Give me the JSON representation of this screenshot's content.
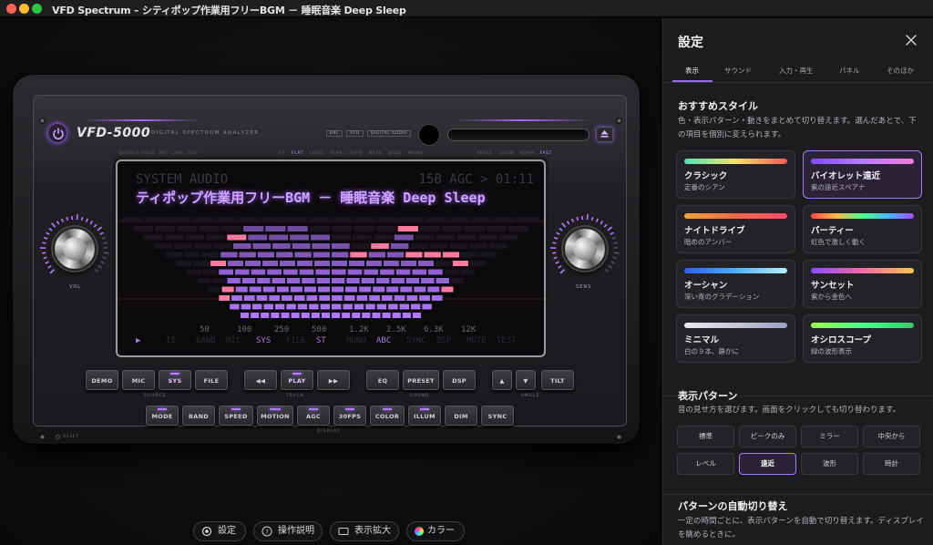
{
  "window": {
    "title": "VFD Spectrum – シティポップ作業用フリーBGM － 睡眠音楽 Deep Sleep"
  },
  "colors": {
    "accent": "#9b6bff",
    "glow": "#b27cff",
    "traffic_red": "#fe5f57",
    "traffic_yellow": "#febc2e",
    "traffic_green": "#28c840"
  },
  "device": {
    "brand": "VFD-5000",
    "subbrand": "DIGITAL SPECTRUM ANALYZER",
    "badges": [
      "BKF",
      "VFD",
      "DIGITAL AUDIO"
    ],
    "source_field_label": "SOURCE FIELD",
    "source_field_items": [
      "MIC",
      "LINE",
      "FILE"
    ],
    "mode_indicators": [
      "FX",
      "FLAT",
      "LOUD",
      "PEAK",
      "AUTO",
      "BASS",
      "WIDE",
      "MONO"
    ],
    "mode_active": "FLAT",
    "speed_label": "SPEED",
    "speed_items": [
      "SLOW",
      "NORM",
      "FAST"
    ],
    "speed_active": "FAST",
    "vol_label": "VOL",
    "sens_label": "SENS",
    "reset_label": "RESET"
  },
  "screen": {
    "header_left": "SYSTEM AUDIO",
    "header_right": "15B AGC > 01:11",
    "song": "ティポップ作業用フリーBGM  －  睡眠音楽  Deep Sleep",
    "freq_labels": [
      "50",
      "100",
      "250",
      "500",
      "1.2K",
      "2.5K",
      "6.3K",
      "12K"
    ],
    "footer_indicators": [
      "▶",
      "II",
      "BAND",
      "MIC",
      "SYS",
      "FILE",
      "ST",
      "MONO",
      "ABC",
      "SYNC",
      "DSP",
      "MUTE",
      "TEST"
    ],
    "footer_active": [
      "▶",
      "SYS",
      "ST",
      "ABC"
    ],
    "spectrum_levels": [
      0.18,
      0.3,
      0.52,
      0.66,
      0.78,
      0.85,
      0.9,
      0.84,
      0.8,
      0.72,
      0.64,
      0.6,
      0.82,
      0.6,
      0.58,
      0.46,
      0.36,
      0.22
    ],
    "spectrum_peaks": [
      0.22,
      0.36,
      0.6,
      0.66,
      0.84,
      0.86,
      0.92,
      0.84,
      0.82,
      0.72,
      0.68,
      0.74,
      0.92,
      0.68,
      0.66,
      0.7,
      0.56,
      0.3
    ]
  },
  "buttons": {
    "source": [
      "DEMO",
      "MIC",
      "SYS",
      "FILE"
    ],
    "source_label": "SOURCE",
    "track": [
      "◀◀",
      "PLAY",
      "▶▶"
    ],
    "track_label": "TRACK",
    "sound": [
      "EQ",
      "PRESET",
      "DSP"
    ],
    "sound_label": "SOUND",
    "angle": [
      "▲",
      "▼",
      "TILT"
    ],
    "angle_label": "ANGLE",
    "display": [
      "MODE",
      "BAND",
      "SPEED",
      "MOTION",
      "AGC",
      "30FPS",
      "COLOR",
      "ILLUM",
      "DIM",
      "SYNC"
    ],
    "display_label": "DISPLAY"
  },
  "bottom_bar": {
    "settings": "設定",
    "help": "操作説明",
    "zoom": "表示拡大",
    "color": "カラー"
  },
  "panel": {
    "title": "設定",
    "tabs": [
      "表示",
      "サウンド",
      "入力・再生",
      "パネル",
      "そのほか"
    ],
    "active_tab": "表示",
    "styles_title": "おすすめスタイル",
    "styles_desc": "色・表示パターン・動きをまとめて切り替えます。選んだあとで、下の項目を個別に変えられます。",
    "styles": [
      {
        "name": "クラシック",
        "desc": "定番のシアン",
        "gradient": "linear-gradient(90deg,#4fe3b6,#f4e36a,#f05a5a)"
      },
      {
        "name": "バイオレット遠近",
        "desc": "紫の遠近スペアナ",
        "gradient": "linear-gradient(90deg,#7b4dff,#b87cff,#f27dd9)",
        "selected": true
      },
      {
        "name": "ナイトドライブ",
        "desc": "暗めのアンバー",
        "gradient": "linear-gradient(90deg,#f2a33a,#ec6a4a,#ff4a6a)"
      },
      {
        "name": "パーティー",
        "desc": "虹色で激しく動く",
        "gradient": "linear-gradient(90deg,#ff4a4a,#ffb84a,#4aff8a,#4ab8ff,#a64aff)"
      },
      {
        "name": "オーシャン",
        "desc": "深い青のグラデーション",
        "gradient": "linear-gradient(90deg,#2a5cff,#4ab0ff,#b8f0ff)"
      },
      {
        "name": "サンセット",
        "desc": "紫から金色へ",
        "gradient": "linear-gradient(90deg,#8a4aff,#f26aa6,#ffc44a)"
      },
      {
        "name": "ミニマル",
        "desc": "白の９本、静かに",
        "gradient": "linear-gradient(90deg,#e8e8ee,#c8c8d4,#9aa0c8)"
      },
      {
        "name": "オシロスコープ",
        "desc": "緑の波形表示",
        "gradient": "linear-gradient(90deg,#9aff4a,#4aff8a,#2ad06a)"
      }
    ],
    "pattern_title": "表示パターン",
    "pattern_desc": "音の見せ方を選びます。画面をクリックしても切り替わります。",
    "patterns": [
      "標準",
      "ピークのみ",
      "ミラー",
      "中央から",
      "レベル",
      "遠近",
      "波形",
      "時計"
    ],
    "pattern_selected": "遠近",
    "auto_title": "パターンの自動切り替え",
    "auto_desc": "一定の時間ごとに、表示パターンを自動で切り替えます。ディスプレイを眺めるときに。"
  }
}
